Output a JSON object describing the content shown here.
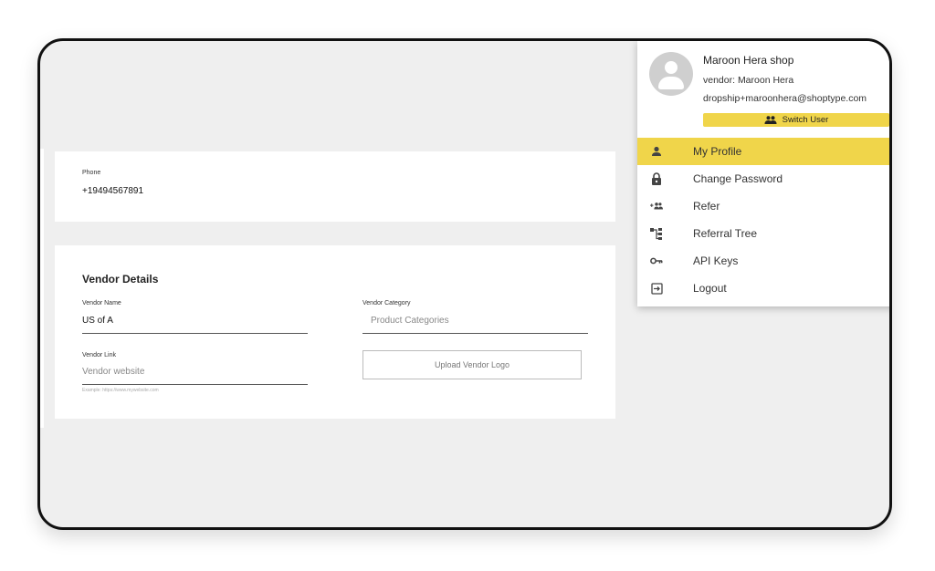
{
  "profile_form": {
    "phone_label": "Phone",
    "phone_value": "+19494567891",
    "vendor_title": "Vendor Details",
    "vendor_name_label": "Vendor Name",
    "vendor_name_value": "US of A",
    "vendor_category_label": "Vendor Category",
    "vendor_category_placeholder": "Product Categories",
    "vendor_link_label": "Vendor Link",
    "vendor_link_placeholder": "Vendor website",
    "vendor_link_hint": "Example: https://www.mywebsite.com",
    "upload_logo_label": "Upload Vendor Logo"
  },
  "user_menu": {
    "shop_name": "Maroon Hera shop",
    "vendor": "vendor: Maroon Hera",
    "email": "dropship+maroonhera@shoptype.com",
    "switch_user_label": "Switch User",
    "accent_color": "#f0d54a",
    "items": [
      {
        "label": "My Profile",
        "icon": "person-icon",
        "active": true
      },
      {
        "label": "Change Password",
        "icon": "lock-icon",
        "active": false
      },
      {
        "label": "Refer",
        "icon": "add-group-icon",
        "active": false
      },
      {
        "label": "Referral Tree",
        "icon": "tree-icon",
        "active": false
      },
      {
        "label": "API Keys",
        "icon": "key-icon",
        "active": false
      },
      {
        "label": "Logout",
        "icon": "logout-icon",
        "active": false
      }
    ]
  }
}
